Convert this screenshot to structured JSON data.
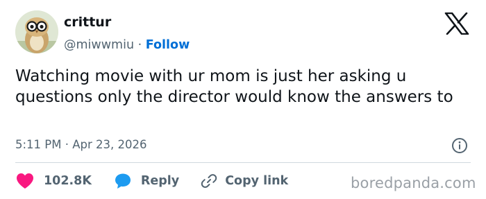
{
  "author": {
    "display_name": "crittur",
    "handle": "@miwwmiu",
    "separator": "·",
    "follow_label": "Follow"
  },
  "tweet": {
    "text": "Watching movie with ur mom is just her asking u questions only the director would know the answers to",
    "timestamp": "5:11 PM · Apr 23, 2026"
  },
  "actions": {
    "likes": "102.8K",
    "reply_label": "Reply",
    "copy_link_label": "Copy link"
  },
  "icons": {
    "platform": "x-logo-icon",
    "info": "info-icon",
    "like": "heart-icon",
    "reply": "speech-bubble-icon",
    "copy": "link-icon"
  },
  "watermark": "boredpanda.com",
  "colors": {
    "text": "#0f1419",
    "secondary": "#536471",
    "follow": "#006fd6",
    "heart": "#f91880",
    "reply": "#1d9bf0",
    "divider": "#cfd9de"
  }
}
